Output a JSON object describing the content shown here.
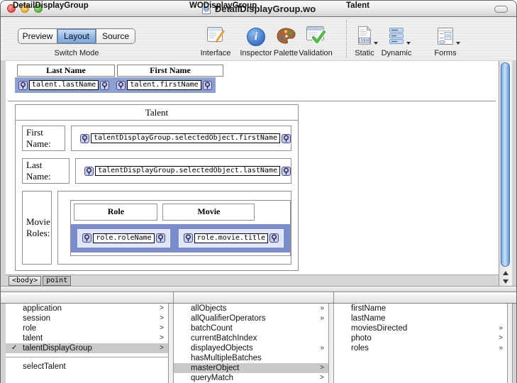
{
  "window": {
    "title": "DetailDisplayGroup.wo"
  },
  "toolbar": {
    "segments": [
      "Preview",
      "Layout",
      "Source"
    ],
    "selected_segment": "Layout",
    "caption": "Switch Mode",
    "tools": [
      {
        "label": "Interface"
      },
      {
        "label": "Inspector",
        "glyph": "i"
      },
      {
        "label": "Palette"
      },
      {
        "label": "Validation"
      }
    ],
    "insert_tools": [
      {
        "label": "Static",
        "icon_text": ".html"
      },
      {
        "label": "Dynamic"
      },
      {
        "label": "Forms"
      }
    ]
  },
  "canvas": {
    "list_table": {
      "columns": [
        {
          "header": "Last Name",
          "binding": "talent.lastName"
        },
        {
          "header": "First Name",
          "binding": "talent.firstName"
        }
      ]
    },
    "detail_table": {
      "caption": "Talent",
      "rows": [
        {
          "label": "First Name:",
          "binding": "talentDisplayGroup.selectedObject.firstName"
        },
        {
          "label": "Last Name:",
          "binding": "talentDisplayGroup.selectedObject.lastName"
        }
      ],
      "movie_roles_row": {
        "label": "Movie Roles:",
        "columns": [
          {
            "header": "Role",
            "binding": "role.roleName"
          },
          {
            "header": "Movie",
            "binding": "role.movie.title"
          }
        ]
      }
    }
  },
  "path_bar": {
    "tags": [
      "<body>",
      "point"
    ]
  },
  "browser": {
    "columns": [
      {
        "title": "DetailDisplayGroup",
        "items": [
          {
            "label": "application",
            "arrow": ">"
          },
          {
            "label": "session",
            "arrow": ">"
          },
          {
            "label": "role",
            "arrow": ">"
          },
          {
            "label": "talent",
            "arrow": ">"
          },
          {
            "label": "talentDisplayGroup",
            "arrow": ">",
            "mark": "✓",
            "selected": true
          }
        ],
        "actions": [
          {
            "label": "selectTalent"
          }
        ]
      },
      {
        "title": "WODisplayGroup",
        "items": [
          {
            "label": "allObjects",
            "arrow": "»"
          },
          {
            "label": "allQualifierOperators",
            "arrow": "»"
          },
          {
            "label": "batchCount"
          },
          {
            "label": "currentBatchIndex"
          },
          {
            "label": "displayedObjects",
            "arrow": "»"
          },
          {
            "label": "hasMultipleBatches"
          },
          {
            "label": "masterObject",
            "arrow": ">",
            "selected": true
          },
          {
            "label": "queryMatch",
            "arrow": ">"
          }
        ]
      },
      {
        "title": "Talent",
        "items": [
          {
            "label": "firstName"
          },
          {
            "label": "lastName"
          },
          {
            "label": "moviesDirected",
            "arrow": "»"
          },
          {
            "label": "photo",
            "arrow": ">"
          },
          {
            "label": "roles",
            "arrow": "»"
          }
        ]
      }
    ]
  },
  "colors": {
    "selection_periwinkle": "#8E9FD3",
    "selection_periwinkle_dark": "#7A8CCB",
    "binding_cell_lavender": "#DCE6F8",
    "segment_selected_blue": "#8FB8E8",
    "scrollbar_aqua": "#6FA5DF",
    "list_selection_gray": "#C9C9C9"
  }
}
